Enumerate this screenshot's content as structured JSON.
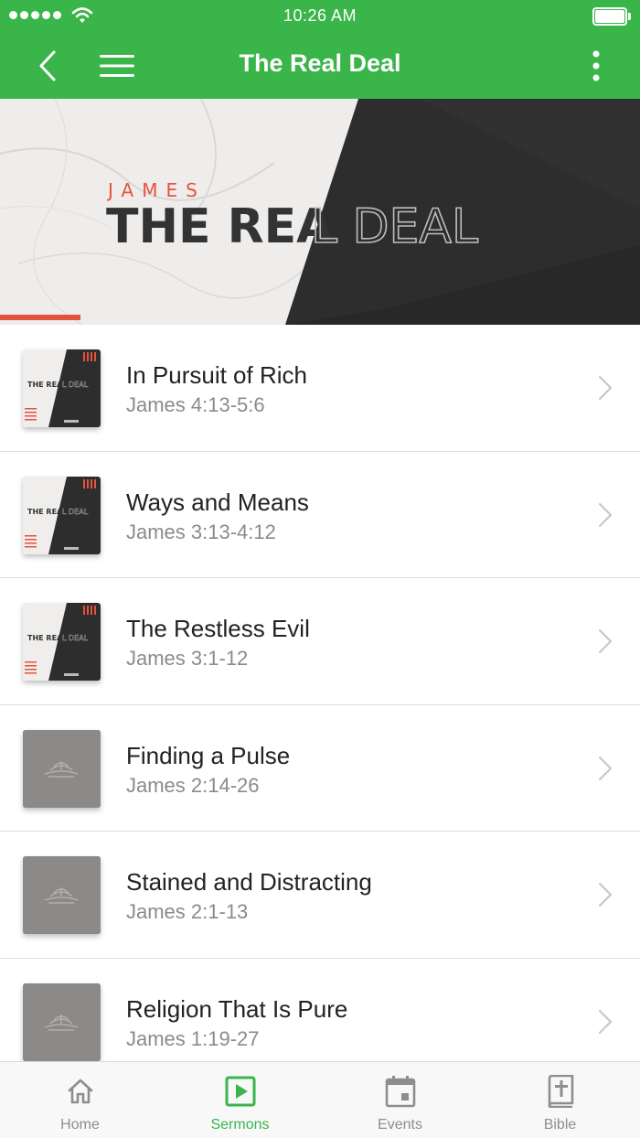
{
  "status_bar": {
    "time": "10:26 AM"
  },
  "nav": {
    "title": "The Real Deal",
    "back_icon": "chevron-left-icon",
    "menu_icon": "hamburger-menu-icon",
    "more_icon": "more-vertical-icon"
  },
  "banner": {
    "subtitle": "JAMES",
    "title_solid": "THE REA",
    "title_outline": "L DEAL",
    "accent_color": "#e4533c"
  },
  "thumb_art": {
    "title_solid": "THE REA",
    "title_outline": "L DEAL"
  },
  "sermons": [
    {
      "title": "In Pursuit of Rich",
      "reference": "James 4:13-5:6",
      "thumb": "series-art"
    },
    {
      "title": "Ways and Means",
      "reference": "James 3:13-4:12",
      "thumb": "series-art"
    },
    {
      "title": "The Restless Evil",
      "reference": "James 3:1-12",
      "thumb": "series-art"
    },
    {
      "title": "Finding a Pulse",
      "reference": "James 2:14-26",
      "thumb": "placeholder"
    },
    {
      "title": "Stained and Distracting",
      "reference": "James 2:1-13",
      "thumb": "placeholder"
    },
    {
      "title": "Religion That Is Pure",
      "reference": "James 1:19-27",
      "thumb": "placeholder"
    }
  ],
  "tabs": [
    {
      "label": "Home",
      "icon": "home-icon",
      "active": false
    },
    {
      "label": "Sermons",
      "icon": "play-square-icon",
      "active": true
    },
    {
      "label": "Events",
      "icon": "calendar-icon",
      "active": false
    },
    {
      "label": "Bible",
      "icon": "bible-icon",
      "active": false
    }
  ],
  "colors": {
    "brand_green": "#3ab54a",
    "accent_red": "#e4533c",
    "text_primary": "#222222",
    "text_secondary": "#8b8b8b"
  }
}
